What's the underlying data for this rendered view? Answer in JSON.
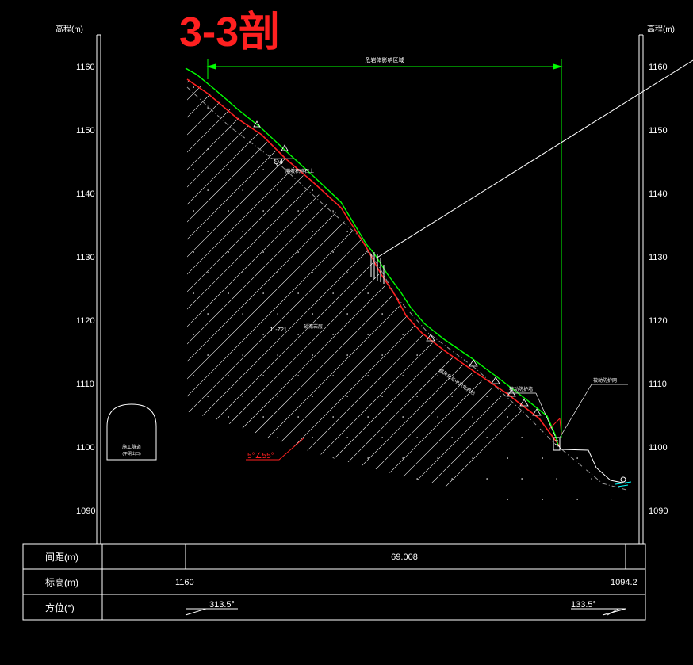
{
  "title": "3-3剖",
  "axis": {
    "label_left": "高程(m)",
    "label_right": "高程(m)",
    "ticks": [
      "1160",
      "1150",
      "1140",
      "1130",
      "1120",
      "1110",
      "1100",
      "1090"
    ]
  },
  "dimension": {
    "label": "危岩体影响区域"
  },
  "labels": {
    "q4": "Q4",
    "deposit": "崩坡积碎石土",
    "rock_code": "J1-Z21",
    "rock_name": "砂泥岩层",
    "interface": "强风化与中风化界线",
    "retaining_wall": "被动防护墙",
    "protective_net": "被动防护网",
    "tunnel": "施工隧道",
    "tunnel_sub": "(平硐出口)",
    "bedding": "5°∠55°"
  },
  "table": {
    "rows": [
      {
        "header": "间距(m)",
        "value": "69.008"
      },
      {
        "header": "标高(m)",
        "start": "1160",
        "end": "1094.2"
      },
      {
        "header": "方位(°)",
        "start": "313.5°",
        "end": "133.5°"
      }
    ]
  },
  "colors": {
    "background": "#000000",
    "frame": "#ffffff",
    "terrain": "#00ff00",
    "boundary_red": "#ff2020",
    "hatch": "#ffffff",
    "interface_line": "#9a9a9a",
    "water_symbol": "#00ffff"
  }
}
